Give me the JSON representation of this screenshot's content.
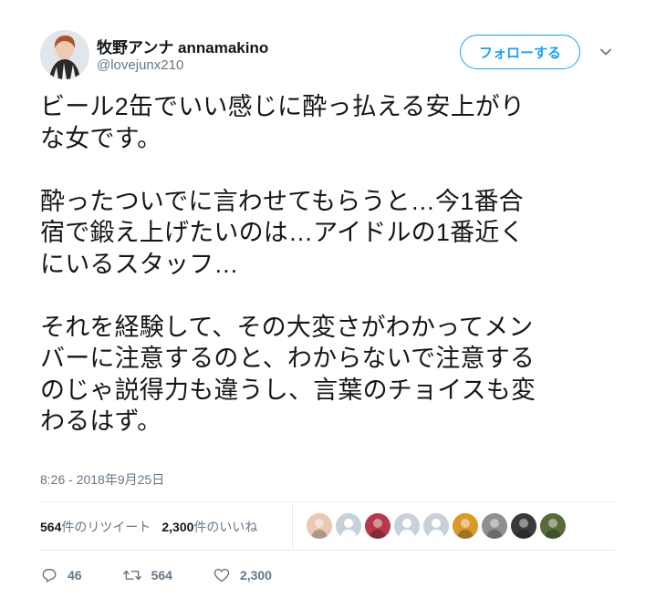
{
  "author": {
    "display_name": "牧野アンナ annamakino",
    "handle": "@lovejunx210"
  },
  "follow_button": {
    "label": "フォローする"
  },
  "tweet": {
    "paragraphs": [
      [
        "ビール2缶でいい感じに酔っ払える安上がり",
        "な女です。"
      ],
      [
        "酔ったついでに言わせてもらうと…今1番合",
        "宿で鍛え上げたいのは…アイドルの1番近く",
        "にいるスタッフ…"
      ],
      [
        "それを経験して、その大変さがわかってメン",
        "バーに注意するのと、わからないで注意する",
        "のじゃ説得力も違うし、言葉のチョイスも変",
        "わるはず。"
      ]
    ]
  },
  "timestamp": "8:26 - 2018年9月25日",
  "stats": {
    "retweets_count": "564",
    "retweets_label": "件のリツイート",
    "likes_count": "2,300",
    "likes_label": "件のいいね"
  },
  "likers": [
    {
      "icon": "photo-avatar",
      "color": "#e9c9b3"
    },
    {
      "icon": "default-avatar",
      "color": "#c8d1d9"
    },
    {
      "icon": "photo-avatar",
      "color": "#b5394a"
    },
    {
      "icon": "default-avatar",
      "color": "#c8d1d9"
    },
    {
      "icon": "default-avatar",
      "color": "#c8d1d9"
    },
    {
      "icon": "photo-avatar",
      "color": "#d89b2b"
    },
    {
      "icon": "photo-avatar",
      "color": "#8f8f8f"
    },
    {
      "icon": "photo-avatar",
      "color": "#3a3a3a"
    },
    {
      "icon": "photo-avatar",
      "color": "#556b3a"
    }
  ],
  "actions": {
    "replies": "46",
    "retweets": "564",
    "likes": "2,300"
  },
  "colors": {
    "accent": "#1da1f2",
    "text": "#14171a",
    "secondary": "#657786",
    "border": "#e6ecf0"
  }
}
